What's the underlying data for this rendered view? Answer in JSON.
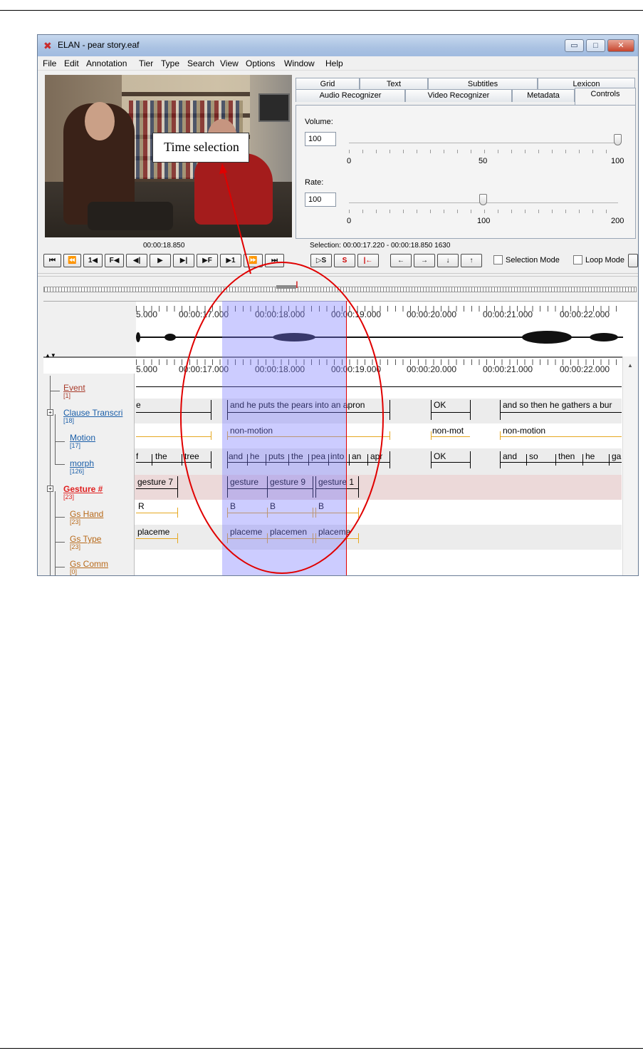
{
  "window": {
    "title": "ELAN - pear story.eaf",
    "controls": {
      "minimize": "▭",
      "maximize": "□",
      "close": "✕"
    }
  },
  "menubar": [
    "File",
    "Edit",
    "Annotation",
    "Tier",
    "Type",
    "Search",
    "View",
    "Options",
    "Window",
    "Help"
  ],
  "tabs": {
    "row1": [
      "Grid",
      "Text",
      "Subtitles",
      "Lexicon"
    ],
    "row2": [
      "Audio Recognizer",
      "Video Recognizer",
      "Metadata",
      "Controls"
    ],
    "active": "Controls"
  },
  "controls_panel": {
    "volume": {
      "label": "Volume:",
      "value": "100",
      "ticks": [
        "0",
        "50",
        "100"
      ],
      "level": 100
    },
    "rate": {
      "label": "Rate:",
      "value": "100",
      "ticks": [
        "0",
        "100",
        "200"
      ],
      "level": 100
    }
  },
  "media_time": "00:00:18.850",
  "selection_text": "Selection: 00:00:17.220 - 00:00:18.850  1630",
  "player_buttons": [
    "⏮",
    "⏪",
    "1◀",
    "F◀",
    "◀|",
    "▶",
    "▶|",
    "▶F",
    "▶1",
    "⏩",
    "⏭"
  ],
  "selection_buttons": [
    "▷S",
    "S",
    "|←"
  ],
  "nav_buttons": [
    "←",
    "→",
    "↓",
    "↑"
  ],
  "checkboxes": {
    "selection_mode": "Selection Mode",
    "loop_mode": "Loop Mode"
  },
  "ruler": [
    "5.000",
    "00:00:17.000",
    "00:00:18.000",
    "00:00:19.000",
    "00:00:20.000",
    "00:00:21.000",
    "00:00:22.000"
  ],
  "tiers": [
    {
      "name": "Event",
      "count": "[1]",
      "color": "#a83a2a"
    },
    {
      "name": "Clause Transcri",
      "count": "[18]",
      "color": "#1a5ea8"
    },
    {
      "name": "Motion",
      "count": "[17]",
      "color": "#1a5ea8"
    },
    {
      "name": "morph",
      "count": "[126]",
      "color": "#1a5ea8"
    },
    {
      "name": "Gesture #",
      "count": "[23]",
      "color": "#e02020"
    },
    {
      "name": "Gs Hand",
      "count": "[23]",
      "color": "#b86a1a"
    },
    {
      "name": "Gs Type",
      "count": "[23]",
      "color": "#b86a1a"
    },
    {
      "name": "Gs Comm",
      "count": "[0]",
      "color": "#b86a1a"
    }
  ],
  "annotations": {
    "clause": [
      "e",
      "and he puts the pears into an apron",
      "OK",
      "and so then he gathers a bur"
    ],
    "motion": [
      "non-motion",
      "non-mot",
      "non-motion"
    ],
    "morph": [
      "f",
      "the",
      "tree",
      "and",
      "he",
      "puts",
      "the",
      "pea",
      "into",
      "an",
      "apr",
      "OK",
      "and",
      "so",
      "then",
      "he",
      "ga"
    ],
    "gesture": [
      "gesture 7",
      "gesture",
      "gesture 9",
      "gesture 1"
    ],
    "gs_hand": [
      "R",
      "B",
      "B",
      "B"
    ],
    "gs_type": [
      "placeme",
      "placeme",
      "placemen",
      "placeme"
    ]
  },
  "callout": "Time selection",
  "colors": {
    "selection": "#7878ff",
    "crosshair": "#e00000",
    "callout": "#e00000",
    "gesture_row": "#ecd9d9"
  }
}
